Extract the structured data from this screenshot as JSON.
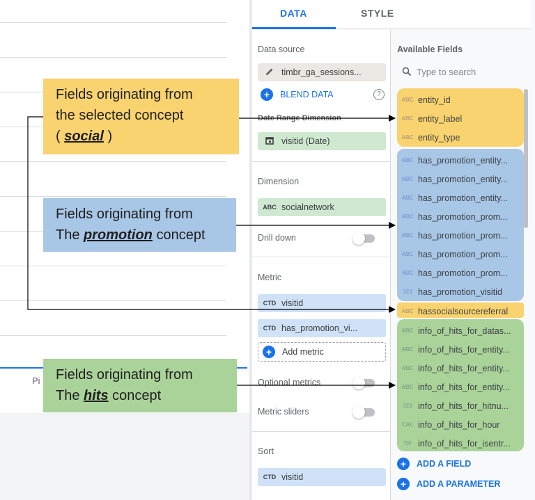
{
  "tabs": {
    "data": "DATA",
    "style": "STYLE"
  },
  "canvas": {
    "tab_label": "Pi"
  },
  "setup": {
    "data_source": {
      "label": "Data source",
      "value": "timbr_ga_sessions..."
    },
    "blend_data": "BLEND DATA",
    "date_range": {
      "label": "Date Range Dimension",
      "value": "visitid (Date)"
    },
    "dimension": {
      "label": "Dimension",
      "type": "ABC",
      "value": "socialnetwork"
    },
    "drill_down": "Drill down",
    "metric": {
      "label": "Metric",
      "items": [
        {
          "type": "CTD",
          "value": "visitid"
        },
        {
          "type": "CTD",
          "value": "has_promotion_vi..."
        }
      ],
      "add_label": "Add metric"
    },
    "optional_metrics": "Optional metrics",
    "metric_sliders": "Metric sliders",
    "sort": {
      "label": "Sort",
      "type": "CTD",
      "value": "visitid"
    }
  },
  "available": {
    "title": "Available Fields",
    "search_placeholder": "Type to search",
    "fields": [
      {
        "type": "ABC",
        "name": "entity_id",
        "group": "social"
      },
      {
        "type": "ABC",
        "name": "entity_label",
        "group": "social"
      },
      {
        "type": "ABC",
        "name": "entity_type",
        "group": "social"
      },
      {
        "type": "ABC",
        "name": "has_promotion_entity...",
        "group": "promotion"
      },
      {
        "type": "ABC",
        "name": "has_promotion_entity...",
        "group": "promotion"
      },
      {
        "type": "ABC",
        "name": "has_promotion_entity...",
        "group": "promotion"
      },
      {
        "type": "ABC",
        "name": "has_promotion_prom...",
        "group": "promotion"
      },
      {
        "type": "ABC",
        "name": "has_promotion_prom...",
        "group": "promotion"
      },
      {
        "type": "ABC",
        "name": "has_promotion_prom...",
        "group": "promotion"
      },
      {
        "type": "ABC",
        "name": "has_promotion_prom...",
        "group": "promotion"
      },
      {
        "type": "123",
        "name": "has_promotion_visitid",
        "group": "promotion"
      },
      {
        "type": "ABC",
        "name": "hassocialsourcereferral",
        "group": "social"
      },
      {
        "type": "ABC",
        "name": "info_of_hits_for_datas...",
        "group": "hits"
      },
      {
        "type": "ABC",
        "name": "info_of_hits_for_entity...",
        "group": "hits"
      },
      {
        "type": "ABC",
        "name": "info_of_hits_for_entity...",
        "group": "hits"
      },
      {
        "type": "ABC",
        "name": "info_of_hits_for_entity...",
        "group": "hits"
      },
      {
        "type": "123",
        "name": "info_of_hits_for_hitnu...",
        "group": "hits"
      },
      {
        "type": "CAL",
        "name": "info_of_hits_for_hour",
        "group": "hits"
      },
      {
        "type": "T|F",
        "name": "info_of_hits_for_isentr...",
        "group": "hits"
      }
    ],
    "add_field": "ADD A FIELD",
    "add_parameter": "ADD A PARAMETER"
  },
  "callouts": {
    "social": {
      "l1": "Fields originating from",
      "l2": "the selected concept",
      "pre": "( ",
      "concept": "social",
      "post": " )"
    },
    "promotion": {
      "l1": "Fields originating from",
      "pre": "The ",
      "concept": "promotion",
      "post": " concept"
    },
    "hits": {
      "l1": "Fields originating from",
      "pre": "The ",
      "concept": "hits",
      "post": " concept"
    }
  },
  "colors": {
    "accent": "#1a73e8",
    "social_group": "#f9d36f",
    "promotion_group": "#a8c6e6",
    "hits_group": "#aad39a"
  }
}
